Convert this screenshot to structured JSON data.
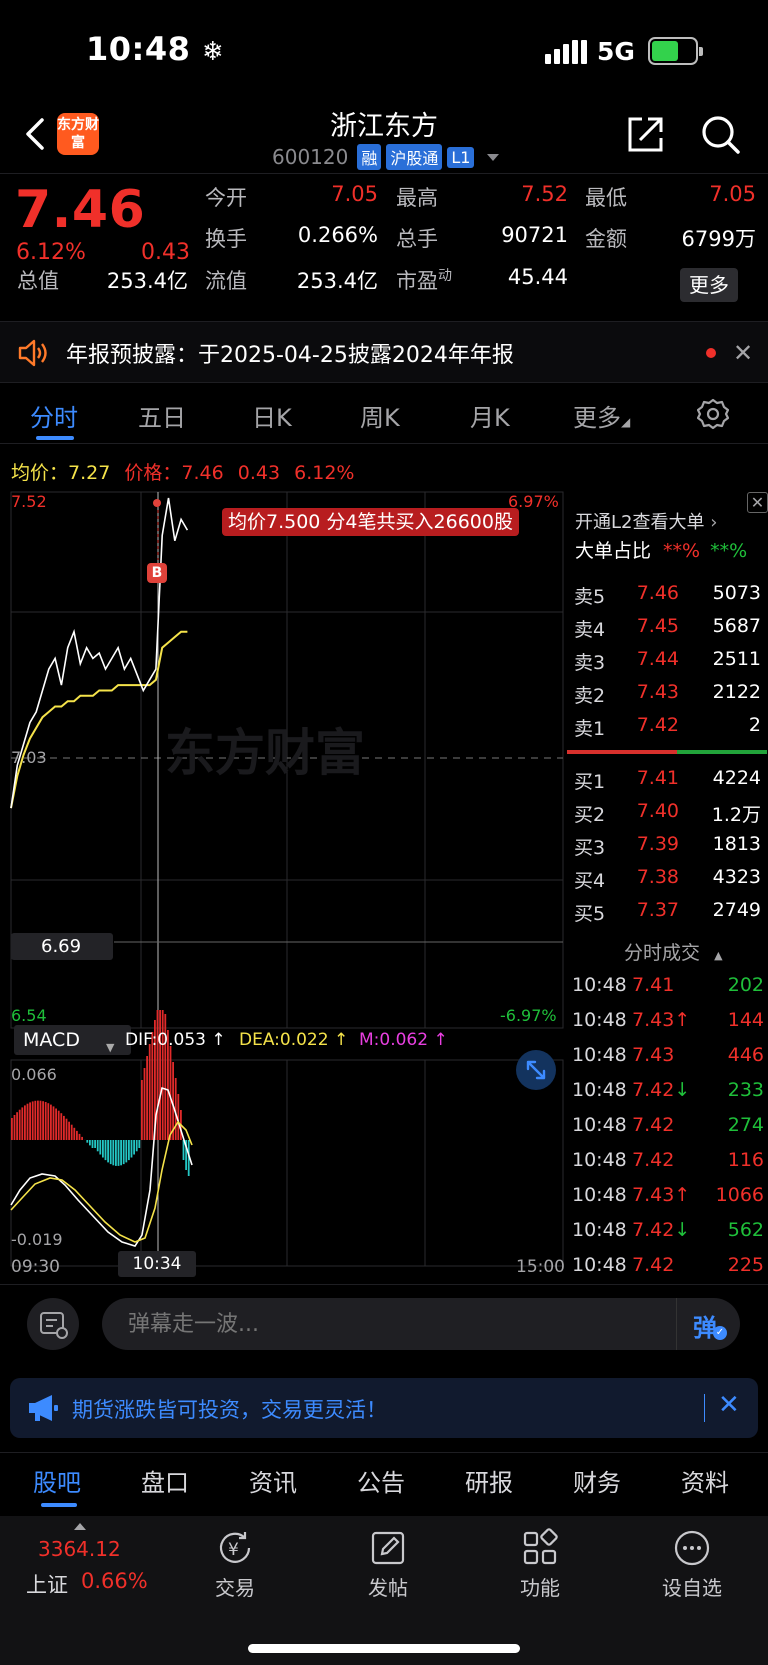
{
  "status": {
    "time": "10:48",
    "network": "5G"
  },
  "header": {
    "app_logo": "东方财富",
    "title": "浙江东方",
    "code": "600120",
    "tags": [
      "融",
      "沪股通",
      "L1"
    ]
  },
  "quote": {
    "price": "7.46",
    "pct": "6.12%",
    "change": "0.43",
    "open_label": "今开",
    "open": "7.05",
    "high_label": "最高",
    "high": "7.52",
    "low_label": "最低",
    "low": "7.05",
    "turnover_label": "换手",
    "turnover": "0.266%",
    "volume_label": "总手",
    "volume": "90721",
    "amount_label": "金额",
    "amount": "6799万",
    "mktcap_label": "总值",
    "mktcap": "253.4亿",
    "float_label": "流值",
    "float_cap": "253.4亿",
    "pe_label": "市盈",
    "pe_sup": "动",
    "pe": "45.44",
    "more": "更多"
  },
  "notice": {
    "text": "年报预披露：于2025-04-25披露2024年年报"
  },
  "chart_tabs": [
    "分时",
    "五日",
    "日K",
    "周K",
    "月K",
    "更多"
  ],
  "legend": {
    "avg_label": "均价：",
    "avg": "7.27",
    "price_label": "价格：",
    "price": "7.46",
    "change": "0.43",
    "pct": "6.12%"
  },
  "chart": {
    "y_top": "7.52",
    "y_top_pct": "6.97%",
    "y_mid": "7.03",
    "y_bottom": "6.54",
    "y_bottom_pct": "-6.97%",
    "crosshair_value": "6.69",
    "tooltip": "均价7.500  分4笔共买入26600股",
    "marker": "B",
    "watermark": "东方财富",
    "macd_select": "MACD",
    "dif": "DIF:0.053 ↑",
    "dea": "DEA:0.022 ↑",
    "m": "M:0.062 ↑",
    "macd_top": "0.066",
    "macd_bottom": "-0.019",
    "time_start": "09:30",
    "time_cross": "10:34",
    "time_end": "15:00"
  },
  "chart_data": {
    "type": "line",
    "x_range": [
      "09:30",
      "15:00"
    ],
    "ylim": [
      6.54,
      7.52
    ],
    "prev_close": 7.03,
    "series": [
      {
        "name": "价格",
        "values": [
          6.94,
          7.02,
          7.06,
          7.1,
          7.12,
          7.16,
          7.2,
          7.22,
          7.17,
          7.24,
          7.27,
          7.21,
          7.24,
          7.22,
          7.23,
          7.2,
          7.22,
          7.24,
          7.2,
          7.22,
          7.19,
          7.16,
          7.18,
          7.2,
          7.45,
          7.52,
          7.44,
          7.48,
          7.46
        ]
      },
      {
        "name": "均价",
        "values": [
          6.94,
          7.0,
          7.04,
          7.07,
          7.09,
          7.11,
          7.12,
          7.13,
          7.13,
          7.14,
          7.14,
          7.15,
          7.15,
          7.15,
          7.16,
          7.16,
          7.16,
          7.17,
          7.17,
          7.17,
          7.17,
          7.17,
          7.17,
          7.18,
          7.24,
          7.25,
          7.26,
          7.27,
          7.27
        ]
      }
    ]
  },
  "book": {
    "l2_link": "开通L2查看大单",
    "big_label": "大单占比",
    "big_red": "**%",
    "big_green": "**%",
    "sells": [
      {
        "label": "卖5",
        "price": "7.46",
        "vol": "5073"
      },
      {
        "label": "卖4",
        "price": "7.45",
        "vol": "5687"
      },
      {
        "label": "卖3",
        "price": "7.44",
        "vol": "2511"
      },
      {
        "label": "卖2",
        "price": "7.43",
        "vol": "2122"
      },
      {
        "label": "卖1",
        "price": "7.42",
        "vol": "2"
      }
    ],
    "buys": [
      {
        "label": "买1",
        "price": "7.41",
        "vol": "4224"
      },
      {
        "label": "买2",
        "price": "7.40",
        "vol": "1.2万"
      },
      {
        "label": "买3",
        "price": "7.39",
        "vol": "1813"
      },
      {
        "label": "买4",
        "price": "7.38",
        "vol": "4323"
      },
      {
        "label": "买5",
        "price": "7.37",
        "vol": "2749"
      }
    ],
    "ticks_title": "分时成交",
    "ticks": [
      {
        "time": "10:48",
        "price": "7.41",
        "arrow": "",
        "vol": "202",
        "color": "green"
      },
      {
        "time": "10:48",
        "price": "7.43",
        "arrow": "↑",
        "vol": "144",
        "color": "red"
      },
      {
        "time": "10:48",
        "price": "7.43",
        "arrow": "",
        "vol": "446",
        "color": "red"
      },
      {
        "time": "10:48",
        "price": "7.42",
        "arrow": "↓",
        "vol": "233",
        "color": "green"
      },
      {
        "time": "10:48",
        "price": "7.42",
        "arrow": "",
        "vol": "274",
        "color": "green"
      },
      {
        "time": "10:48",
        "price": "7.42",
        "arrow": "",
        "vol": "116",
        "color": "red"
      },
      {
        "time": "10:48",
        "price": "7.43",
        "arrow": "↑",
        "vol": "1066",
        "color": "red"
      },
      {
        "time": "10:48",
        "price": "7.42",
        "arrow": "↓",
        "vol": "562",
        "color": "green"
      },
      {
        "time": "10:48",
        "price": "7.42",
        "arrow": "",
        "vol": "225",
        "color": "red"
      }
    ]
  },
  "comment": {
    "placeholder": "弹幕走一波..."
  },
  "promo": {
    "text": "期货涨跌皆可投资，交易更灵活！"
  },
  "bottom_tabs": [
    "股吧",
    "盘口",
    "资讯",
    "公告",
    "研报",
    "财务",
    "资料"
  ],
  "toolbar": {
    "index_value": "3364.12",
    "index_name": "上证",
    "index_pct": "0.66%",
    "items": [
      "交易",
      "发帖",
      "功能",
      "设自选"
    ]
  },
  "colors": {
    "up": "#f0302a",
    "down": "#1fbf3a",
    "accent": "#3d8bff",
    "avg_line": "#f5e34a",
    "dea": "#f5e34a",
    "m": "#e83fe0"
  }
}
